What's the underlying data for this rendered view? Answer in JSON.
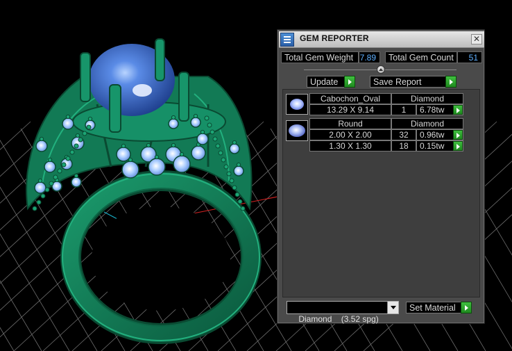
{
  "panel": {
    "title": "GEM REPORTER",
    "close_glyph": "✕",
    "icons": {
      "app": "gem-reporter-icon",
      "close": "close-icon"
    }
  },
  "totals": {
    "weight_label": "Total Gem Weight",
    "weight_value": "7.89",
    "count_label": "Total Gem Count",
    "count_value": "51"
  },
  "buttons": {
    "update": "Update",
    "save_report": "Save Report",
    "set_material": "Set Material"
  },
  "gems": [
    {
      "icon": "oval-gem-icon",
      "cut": "Cabochon_Oval",
      "material": "Diamond",
      "rows": [
        {
          "size": "13.29 X 9.14",
          "count": "1",
          "weight": "6.78tw"
        }
      ]
    },
    {
      "icon": "round-gem-icon",
      "cut": "Round",
      "material": "Diamond",
      "rows": [
        {
          "size": "2.00 X 2.00",
          "count": "32",
          "weight": "0.96tw"
        },
        {
          "size": "1.30 X 1.30",
          "count": "18",
          "weight": "0.15tw"
        }
      ]
    }
  ],
  "material_select": {
    "selected": "Diamond    (3.52 spg)"
  },
  "colors": {
    "ring_green": "#127a55",
    "gem_blue": "#3b6fd0",
    "stone_light_blue": "#9fc6ff",
    "grid_line": "#6e6e6e",
    "axis_red": "#c82020",
    "axis_cyan": "#18b0c8",
    "value_blue": "#5fb0ff",
    "button_arrow_green": "#2aa52a"
  }
}
